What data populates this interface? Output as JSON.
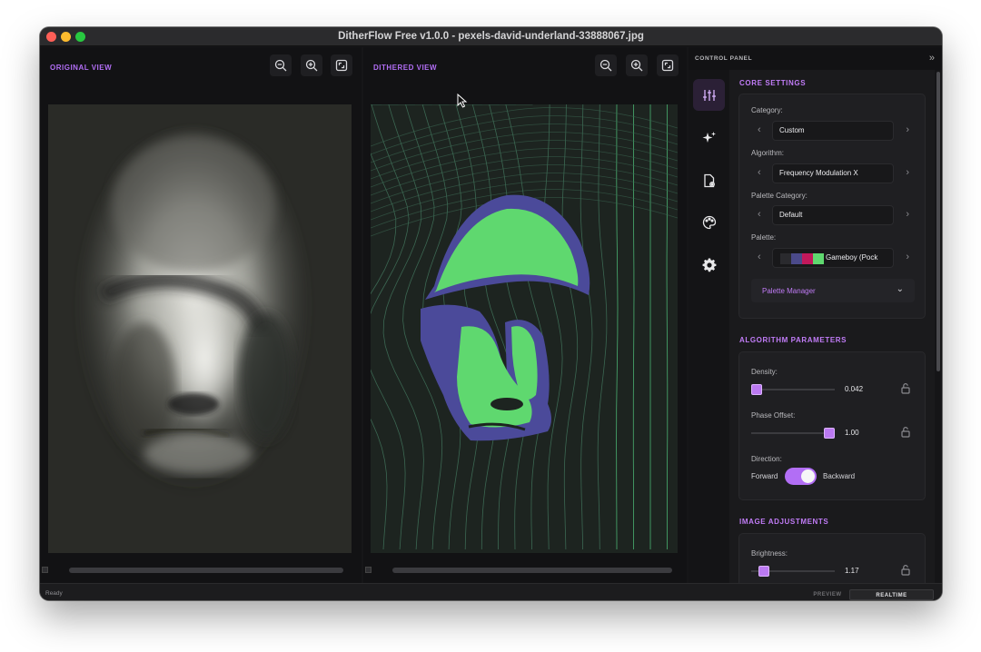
{
  "window": {
    "title": "DitherFlow Free v1.0.0 - pexels-david-underland-33888067.jpg"
  },
  "views": {
    "original": {
      "label": "ORIGINAL VIEW"
    },
    "dithered": {
      "label": "DITHERED VIEW"
    }
  },
  "control_panel": {
    "title": "CONTROL PANEL",
    "rail": [
      "sliders-icon",
      "sparkle-icon",
      "file-settings-icon",
      "palette-icon",
      "gear-icon"
    ],
    "core_settings": {
      "title": "CORE SETTINGS",
      "category_label": "Category:",
      "category_value": "Custom",
      "algorithm_label": "Algorithm:",
      "algorithm_value": "Frequency Modulation X",
      "palette_category_label": "Palette Category:",
      "palette_category_value": "Default",
      "palette_label": "Palette:",
      "palette_value": "Gameboy (Pock",
      "palette_swatches": [
        "#2a2a2e",
        "#4b4a8a",
        "#c2185b",
        "#5fd86f"
      ],
      "palette_manager_label": "Palette Manager"
    },
    "algorithm_parameters": {
      "title": "ALGORITHM PARAMETERS",
      "density_label": "Density:",
      "density_value": "0.042",
      "density_fraction": 0.0,
      "phase_offset_label": "Phase Offset:",
      "phase_offset_value": "1.00",
      "phase_offset_fraction": 1.0,
      "direction_label": "Direction:",
      "direction_forward": "Forward",
      "direction_backward": "Backward",
      "direction_on": true
    },
    "image_adjustments": {
      "title": "IMAGE ADJUSTMENTS",
      "brightness_label": "Brightness:",
      "brightness_value": "1.17",
      "brightness_fraction": 0.1
    }
  },
  "statusbar": {
    "status": "Ready",
    "preview_label": "PREVIEW",
    "realtime_label": "REALTIME"
  },
  "colors": {
    "accent": "#b26ef5",
    "dither_green": "#5fd86f",
    "dither_purple": "#4b4a9a"
  }
}
